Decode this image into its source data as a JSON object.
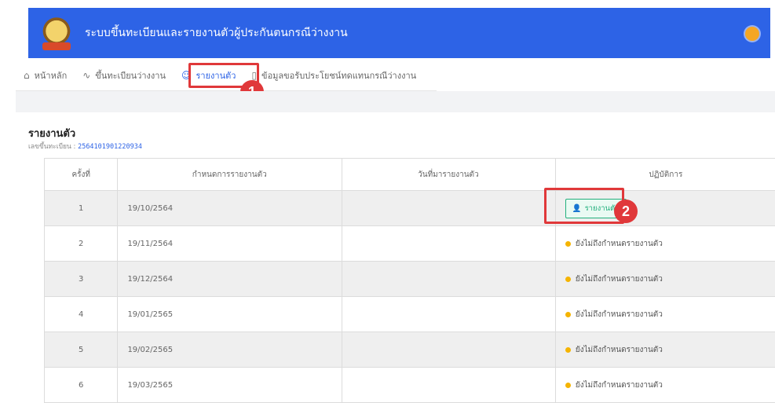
{
  "app": {
    "title": "ระบบขึ้นทะเบียนและรายงานตัวผู้ประกันตนกรณีว่างงาน"
  },
  "nav": {
    "items": [
      {
        "label": "หน้าหลัก",
        "icon": "home-icon"
      },
      {
        "label": "ขึ้นทะเบียนว่างงาน",
        "icon": "pulse-icon"
      },
      {
        "label": "รายงานตัว",
        "icon": "user-icon",
        "active": true
      },
      {
        "label": "ข้อมูลขอรับประโยชน์ทดแทนกรณีว่างงาน",
        "icon": "book-icon"
      }
    ]
  },
  "callouts": {
    "one": "1",
    "two": "2"
  },
  "page": {
    "title": "รายงานตัว",
    "reg_label": "เลขขึ้นทะเบียน : ",
    "reg_number": "2564101901220934"
  },
  "table": {
    "headers": {
      "no": "ครั้งที่",
      "due": "กำหนดการรายงานตัว",
      "date": "วันที่มารายงานตัว",
      "action": "ปฏิบัติการ"
    },
    "rows": [
      {
        "no": "1",
        "due": "19/10/2564",
        "date": "",
        "action_type": "button",
        "action": "รายงานตัว"
      },
      {
        "no": "2",
        "due": "19/11/2564",
        "date": "",
        "action_type": "status",
        "action": "ยังไม่ถึงกำหนดรายงานตัว"
      },
      {
        "no": "3",
        "due": "19/12/2564",
        "date": "",
        "action_type": "status",
        "action": "ยังไม่ถึงกำหนดรายงานตัว"
      },
      {
        "no": "4",
        "due": "19/01/2565",
        "date": "",
        "action_type": "status",
        "action": "ยังไม่ถึงกำหนดรายงานตัว"
      },
      {
        "no": "5",
        "due": "19/02/2565",
        "date": "",
        "action_type": "status",
        "action": "ยังไม่ถึงกำหนดรายงานตัว"
      },
      {
        "no": "6",
        "due": "19/03/2565",
        "date": "",
        "action_type": "status",
        "action": "ยังไม่ถึงกำหนดรายงานตัว"
      }
    ]
  },
  "colors": {
    "header": "#2d63e6",
    "highlight": "#e0383a",
    "button": "#23b07d",
    "status_dot": "#f5b400"
  }
}
